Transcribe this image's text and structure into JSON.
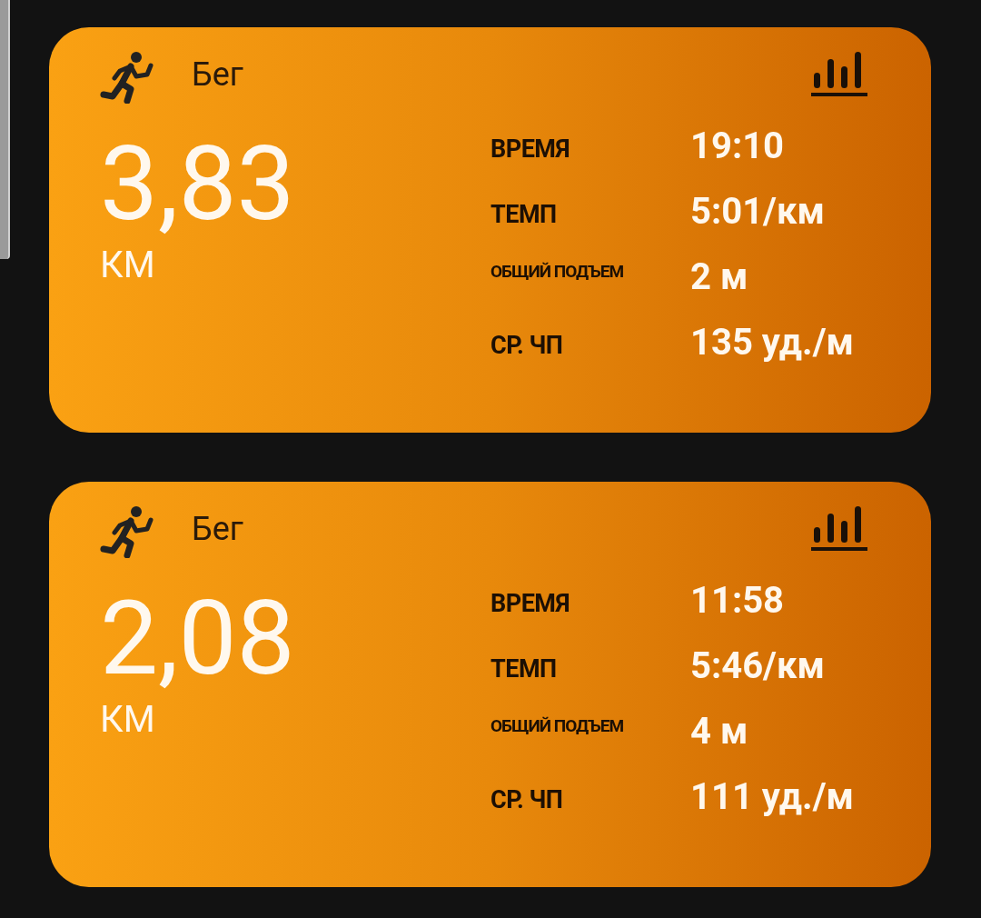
{
  "workouts": [
    {
      "activity": "Бег",
      "distance": "3,83",
      "unit": "КМ",
      "stats": [
        {
          "kind": "normal",
          "label": "ВРЕМЯ",
          "value": "19:10"
        },
        {
          "kind": "normal",
          "label": "ТЕМП",
          "value": "5:01/км"
        },
        {
          "kind": "compact",
          "label": "ОБЩИЙ ПОДЪЕМ",
          "value": "2 м"
        },
        {
          "kind": "normal",
          "label": "СР. ЧП",
          "value": "135 уд./м"
        }
      ]
    },
    {
      "activity": "Бег",
      "distance": "2,08",
      "unit": "КМ",
      "stats": [
        {
          "kind": "normal",
          "label": "ВРЕМЯ",
          "value": "11:58"
        },
        {
          "kind": "normal",
          "label": "ТЕМП",
          "value": "5:46/км"
        },
        {
          "kind": "compact",
          "label": "ОБЩИЙ ПОДЪЕМ",
          "value": "4 м"
        },
        {
          "kind": "normal",
          "label": "СР. ЧП",
          "value": "111 уд./м"
        }
      ]
    }
  ]
}
